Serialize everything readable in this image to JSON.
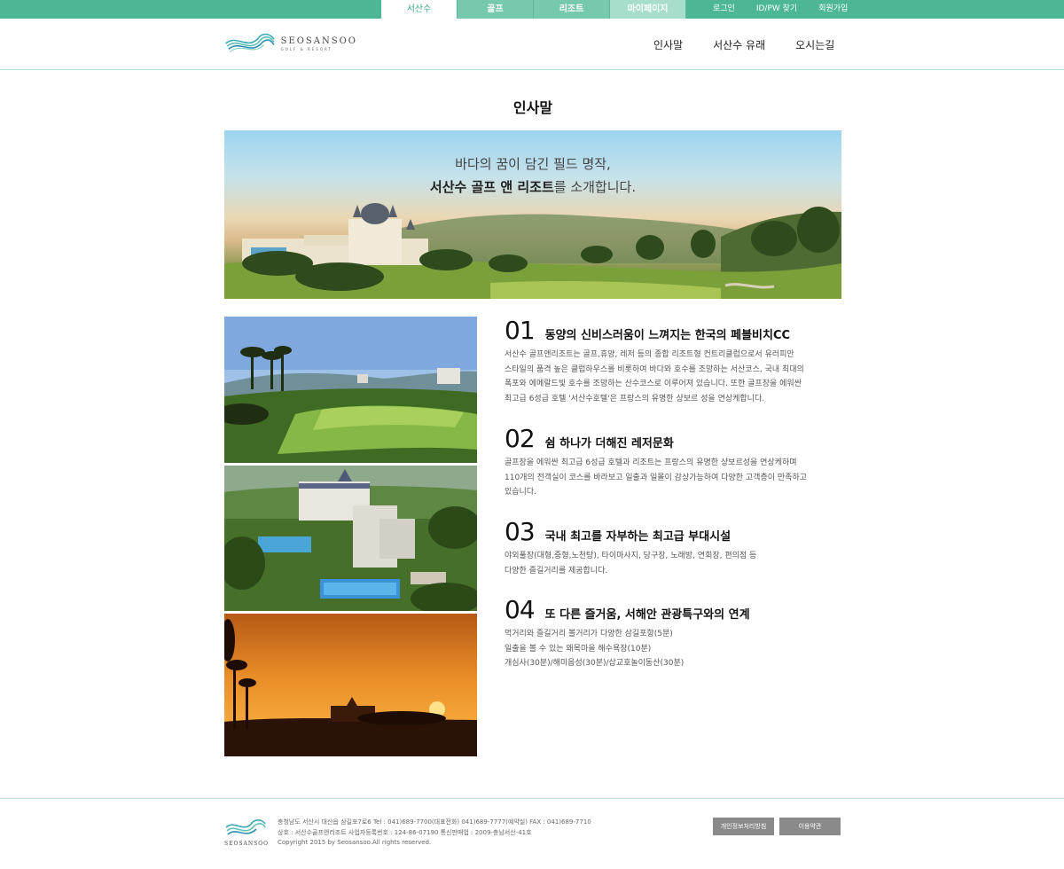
{
  "topbar": {
    "tabs": [
      "서산수",
      "골프",
      "리조트",
      "마이페이지"
    ],
    "links": [
      "로그인",
      "ID/PW 찾기",
      "회원가입"
    ]
  },
  "header": {
    "logo_name": "SEOSANSOO",
    "logo_sub": "GOLF & RESORT",
    "nav": [
      "인사말",
      "서산수 유래",
      "오시는길"
    ]
  },
  "page_title": "인사말",
  "hero": {
    "line1": "바다의 꿈이 담긴 필드 명작,",
    "line2_bold": "서산수 골프 앤 리조트",
    "line2_rest": "를 소개합니다."
  },
  "features": [
    {
      "num": "01",
      "title": "동양의 신비스러움이 느껴지는 한국의 페블비치CC",
      "lines": [
        "서산수 골프앤리조트는 골프,휴양, 레저 등의 종합 리조트형 컨트리클럽으로서 유러피안",
        "스타일의 품격 높은 클럽하우스를 비롯하여 바다와 호수를 조망하는 서산코스, 국내 최대의",
        "폭포와 에메랄드빛 호수를 조망하는 산수코스로 이루어져 있습니다. 또한 골프장을 에워싼",
        "최고급 6성급 호텔 '서산수호텔'은 프랑스의 유명한 샹보르 성을 연상케합니다."
      ]
    },
    {
      "num": "02",
      "title": "쉼 하나가 더해진 레저문화",
      "lines": [
        "골프장을 에워싼 최고급 6성급 호텔과 리조트는 프랑스의 유명한 샹보르성을 연상케하며",
        "110개의 전객실이 코스를 바라보고 일출과 일몰이 감상가능하여 다양한 고객층이 만족하고",
        "있습니다."
      ]
    },
    {
      "num": "03",
      "title": "국내 최고를 자부하는 최고급 부대시설",
      "lines": [
        "야외풀장(대형,중형,노천탕), 타이마사지, 당구장, 노래방, 연회장, 편의점 등",
        "다양한 즐길거리를 제공합니다."
      ]
    },
    {
      "num": "04",
      "title": "또 다른 즐거움, 서해안 관광특구와의 연계",
      "lines": [
        "먹거리와 즐길거리 볼거리가 다양한 삼길포항(5분)",
        "일출을 볼 수 있는 왜목마을 해수욕장(10분)",
        "개심사(30분)/해미읍성(30분)/삽교호놀이동산(30분)"
      ]
    }
  ],
  "footer": {
    "logo_name": "SEOSANSOO",
    "info": [
      "충청남도 서산시 대산읍 삼길포7로6 Tel : 041)689-7700(대표전화) 041)689-7777(예약실) FAX : 041)689-7710",
      "상호 : 서산수골프앤리조트 사업자등록번호 : 124-86-07190 통신판매업 : 2009-충남서산-41호",
      "Copyright 2015 by Seosansoo.All rights reserved."
    ],
    "privacy_button": "개인정보처리방침",
    "terms_button": "이용약관"
  },
  "colors": {
    "accent": "#4db694",
    "tab_inactive": "#76c9ad",
    "tab_light": "#a6ddcb",
    "footer_button": "#8a8a8a"
  }
}
